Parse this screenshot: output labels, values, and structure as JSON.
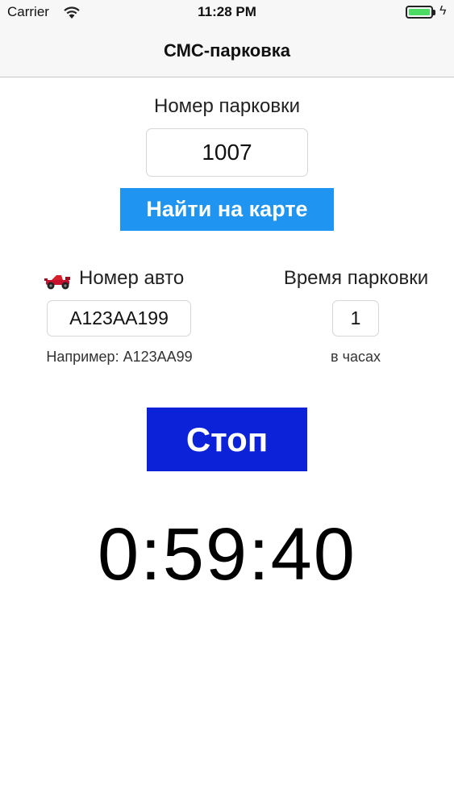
{
  "status_bar": {
    "carrier": "Carrier",
    "time": "11:28 PM",
    "battery_level": 1.0,
    "battery_color": "#4cd964"
  },
  "nav": {
    "title": "СМС-парковка"
  },
  "parking": {
    "label": "Номер парковки",
    "value": "1007",
    "map_button_label": "Найти на карте",
    "map_button_color": "#1f94f0"
  },
  "car": {
    "icon": "race-car-icon",
    "label": "Номер авто",
    "value": "А123АА199",
    "hint": "Например: А123АА99"
  },
  "duration": {
    "label": "Время парковки",
    "value": "1",
    "hint": "в часах"
  },
  "stop_button": {
    "label": "Стоп",
    "color": "#0b22d8"
  },
  "timer": {
    "value": "0:59:40"
  }
}
